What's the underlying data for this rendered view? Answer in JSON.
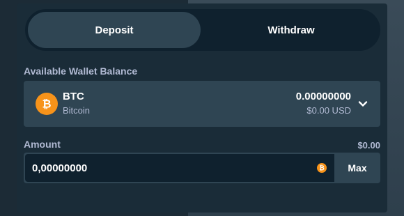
{
  "tabs": {
    "deposit_label": "Deposit",
    "withdraw_label": "Withdraw"
  },
  "wallet": {
    "section_label": "Available Wallet Balance",
    "coin_symbol": "BTC",
    "coin_name": "Bitcoin",
    "balance": "0.00000000",
    "balance_usd": "$0.00 USD",
    "coin_icon": "bitcoin-icon",
    "coin_color": "#f7931a"
  },
  "amount": {
    "label": "Amount",
    "usd_value": "$0.00",
    "input_value": "0,00000000",
    "max_label": "Max"
  }
}
